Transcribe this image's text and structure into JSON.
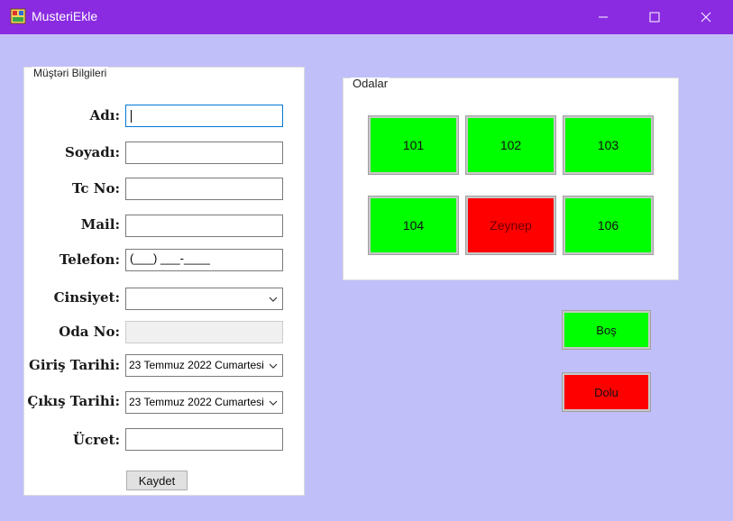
{
  "window": {
    "title": "MusteriEkle"
  },
  "customer_group": {
    "legend": "Müştəri Bilgileri",
    "fields": {
      "ad": {
        "label": "Adı:",
        "value": ""
      },
      "soyad": {
        "label": "Soyadı:",
        "value": ""
      },
      "tc": {
        "label": "Tc No:",
        "value": ""
      },
      "mail": {
        "label": "Mail:",
        "value": ""
      },
      "telefon": {
        "label": "Telefon:",
        "value": "(___) ___-____"
      },
      "cinsiyet": {
        "label": "Cinsiyet:",
        "value": ""
      },
      "oda_no": {
        "label": "Oda No:",
        "value": ""
      },
      "giris": {
        "label": "Giriş Tarihi:",
        "value": "23 Temmuz 2022 Cumartesi"
      },
      "cikis": {
        "label": "Çıkış Tarihi:",
        "value": "23 Temmuz 2022 Cumartesi"
      },
      "ucret": {
        "label": "Ücret:",
        "value": ""
      }
    },
    "save_button": "Kaydet"
  },
  "rooms_group": {
    "legend": "Odalar",
    "rooms": [
      {
        "label": "101",
        "status": "bos"
      },
      {
        "label": "102",
        "status": "bos"
      },
      {
        "label": "103",
        "status": "bos"
      },
      {
        "label": "104",
        "status": "bos"
      },
      {
        "label": "Zeynep",
        "status": "dolu"
      },
      {
        "label": "106",
        "status": "bos"
      }
    ]
  },
  "legend_buttons": {
    "empty": "Boş",
    "full": "Dolu"
  },
  "colors": {
    "title_bar": "#8a2be2",
    "background": "#c1bff9",
    "empty_room": "#00ff00",
    "full_room": "#ff0000"
  }
}
